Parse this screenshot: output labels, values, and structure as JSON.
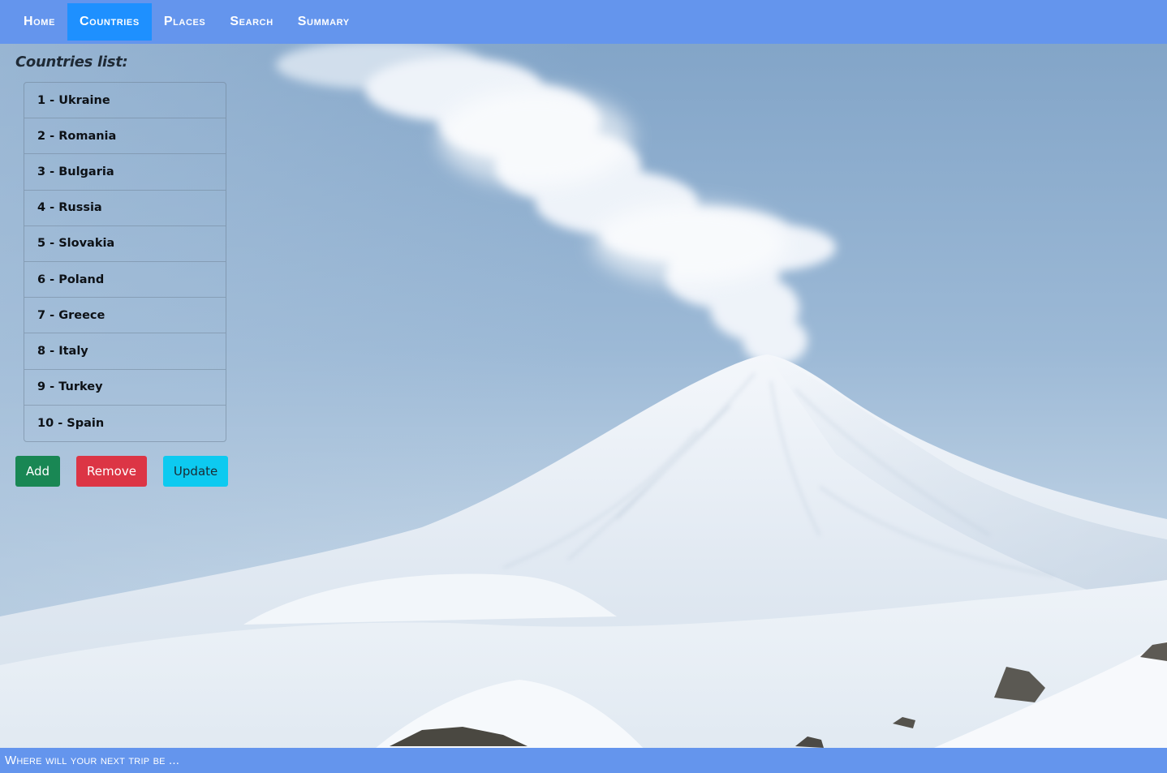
{
  "nav": {
    "items": [
      {
        "label": "Home",
        "active": false
      },
      {
        "label": "Countries",
        "active": true
      },
      {
        "label": "Places",
        "active": false
      },
      {
        "label": "Search",
        "active": false
      },
      {
        "label": "Summary",
        "active": false
      }
    ],
    "color": "#6495ed",
    "active_color": "#1e90ff"
  },
  "main": {
    "title": "Countries list:",
    "countries": [
      "1 - Ukraine",
      "2 - Romania",
      "3 - Bulgaria",
      "4 - Russia",
      "5 - Slovakia",
      "6 - Poland",
      "7 - Greece",
      "8 - Italy",
      "9 - Turkey",
      "10 - Spain"
    ],
    "buttons": {
      "add": "Add",
      "remove": "Remove",
      "update": "Update"
    }
  },
  "background": {
    "icon": "volcano-landscape-image"
  },
  "footer": {
    "text": "Where will your next trip be ..."
  }
}
